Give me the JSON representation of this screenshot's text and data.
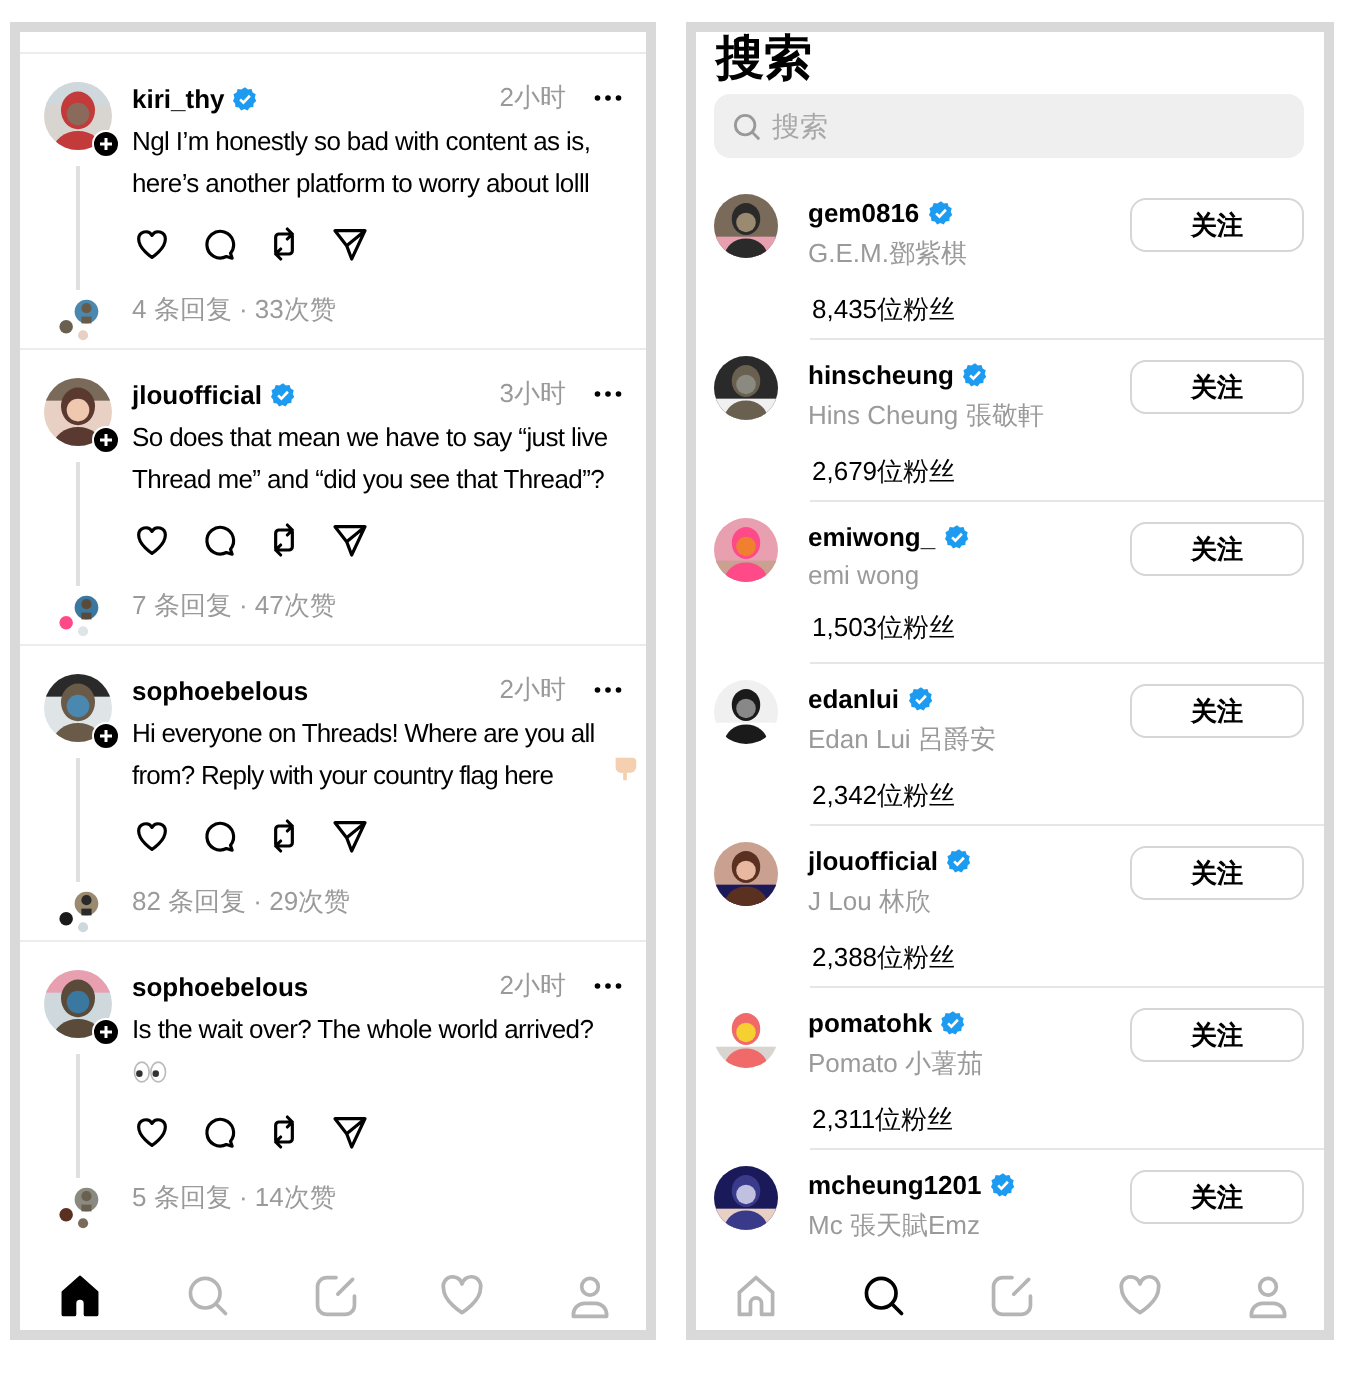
{
  "panels": [
    {
      "kind": "feed",
      "posts": [
        {
          "username": "kiri_thy",
          "verified": true,
          "time": "2小时",
          "text": "Ngl I’m honestly so bad with content as is, here’s another platform to worry about lolll",
          "stats": "4 条回复 · 33次赞"
        },
        {
          "username": "jlouofficial",
          "verified": true,
          "time": "3小时",
          "text": "So does that mean we have to say “just live Thread me” and “did you see that Thread”?",
          "stats": "7 条回复 · 47次赞"
        },
        {
          "username": "sophoebelous",
          "verified": false,
          "time": "2小时",
          "text": "Hi everyone on Threads! Where are you all from? Reply with your country flag here",
          "kind": "hand-emoji",
          "stats": "82 条回复 · 29次赞"
        },
        {
          "username": "sophoebelous",
          "verified": false,
          "time": "2小时",
          "text": "Is the wait over? The whole world arrived?",
          "kind": "eyes-emoji",
          "stats": "5 条回复 · 14次赞"
        }
      ],
      "nav": [
        {
          "kind": "home",
          "selected": true
        },
        {
          "kind": "search",
          "selected": false
        },
        {
          "kind": "compose",
          "selected": false
        },
        {
          "kind": "activity",
          "selected": false
        },
        {
          "kind": "profile",
          "selected": false
        }
      ]
    },
    {
      "kind": "search",
      "title": "搜索",
      "search": {
        "placeholder": "搜索"
      },
      "results": [
        {
          "username": "gem0816",
          "verified": true,
          "full_name": "G.E.M.鄧紫棋",
          "followers": "8,435位粉丝",
          "button": "关注"
        },
        {
          "username": "hinscheung",
          "verified": true,
          "full_name": "Hins Cheung 張敬軒",
          "followers": "2,679位粉丝",
          "button": "关注"
        },
        {
          "username": "emiwong_",
          "verified": true,
          "full_name": "emi wong",
          "followers": "1,503位粉丝",
          "button": "关注"
        },
        {
          "username": "edanlui",
          "verified": true,
          "full_name": "Edan Lui  呂爵安",
          "followers": "2,342位粉丝",
          "button": "关注"
        },
        {
          "username": "jlouofficial",
          "verified": true,
          "full_name": "J Lou 林欣",
          "followers": "2,388位粉丝",
          "button": "关注"
        },
        {
          "username": "pomatohk",
          "verified": true,
          "full_name": "Pomato 小薯茄",
          "followers": "2,311位粉丝",
          "button": "关注"
        },
        {
          "username": "mcheung1201",
          "verified": true,
          "full_name": "Mc 張天賦Emz",
          "button": "关注"
        }
      ],
      "nav": [
        {
          "kind": "home",
          "selected": false
        },
        {
          "kind": "search",
          "selected": true
        },
        {
          "kind": "compose",
          "selected": false
        },
        {
          "kind": "activity",
          "selected": false
        },
        {
          "kind": "profile",
          "selected": false
        }
      ]
    }
  ]
}
